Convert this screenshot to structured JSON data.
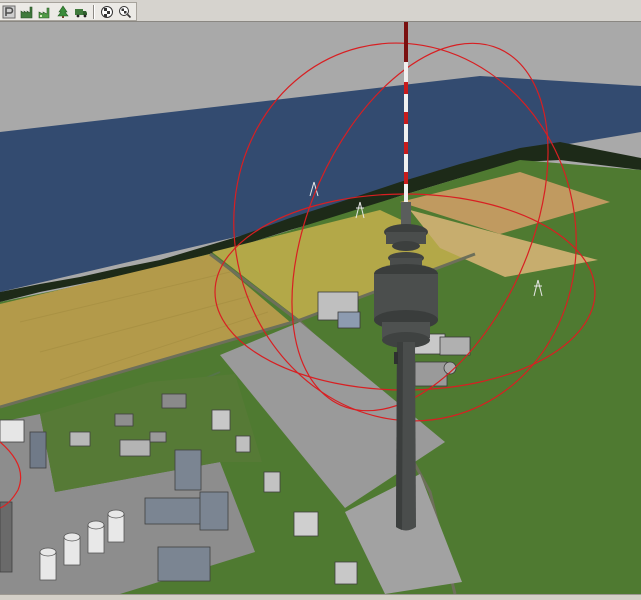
{
  "toolbar": {
    "buttons": [
      {
        "icon": "parking-lot-icon"
      },
      {
        "icon": "factory-icon"
      },
      {
        "icon": "green-factory-icon"
      },
      {
        "icon": "tree-plant-icon"
      },
      {
        "icon": "truck-icon"
      },
      {
        "icon": "checker-globe-icon"
      },
      {
        "icon": "checker-globe-magnify-icon"
      }
    ]
  },
  "scene": {
    "description_colors": {
      "sky": "#a6a6a6",
      "water": "#334d73",
      "grass": "#4f7a31",
      "field_yellow": "#b3a042",
      "field_tan": "#c4a060",
      "concrete": "#9a9a9a",
      "tower": "#4a4d4c",
      "selection_ring": "#e02020"
    }
  }
}
